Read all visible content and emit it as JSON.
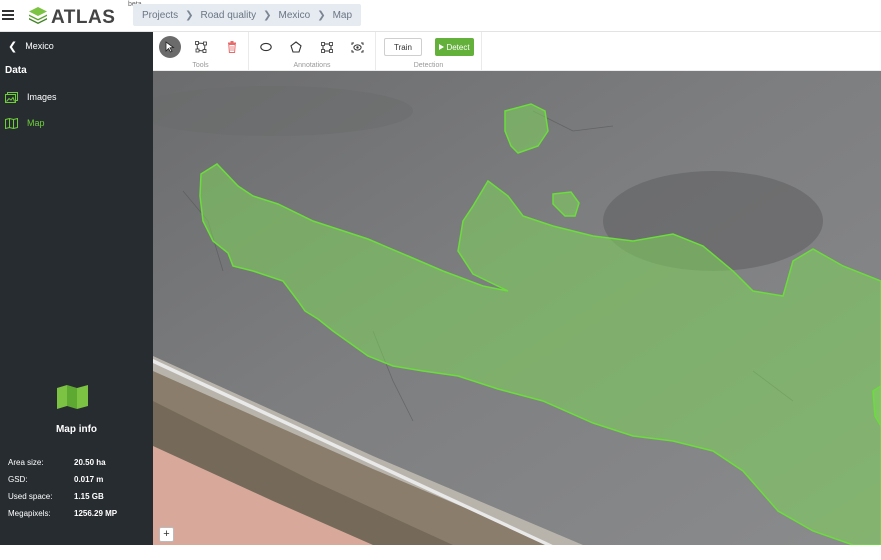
{
  "app": {
    "name": "ATLAS",
    "badge": "beta"
  },
  "breadcrumb": [
    "Projects",
    "Road quality",
    "Mexico",
    "Map"
  ],
  "sidebar": {
    "back_label": "Mexico",
    "section_title": "Data",
    "items": [
      {
        "label": "Images",
        "icon": "images-icon",
        "active": false
      },
      {
        "label": "Map",
        "icon": "map-icon",
        "active": true
      }
    ],
    "map_info": {
      "title": "Map info",
      "rows": [
        {
          "key": "Area size:",
          "value": "20.50 ha"
        },
        {
          "key": "GSD:",
          "value": "0.017 m"
        },
        {
          "key": "Used space:",
          "value": "1.15 GB"
        },
        {
          "key": "Megapixels:",
          "value": "1256.29 MP"
        }
      ]
    }
  },
  "toolbar": {
    "groups": [
      {
        "label": "Tools",
        "tools": [
          "pointer-icon",
          "polygon-select-icon",
          "delete-icon"
        ]
      },
      {
        "label": "Annotations",
        "tools": [
          "ellipse-icon",
          "polygon-icon",
          "rectangle-icon",
          "object-detect-icon"
        ]
      },
      {
        "label": "Detection",
        "train_label": "Train",
        "detect_label": "Detect"
      }
    ]
  },
  "map": {
    "zoom_in_label": "+"
  },
  "colors": {
    "accent": "#63b03b",
    "sidebar_bg": "#272c31",
    "annotation_fill": "#7fd65b",
    "annotation_stroke": "#6bdd3c"
  }
}
